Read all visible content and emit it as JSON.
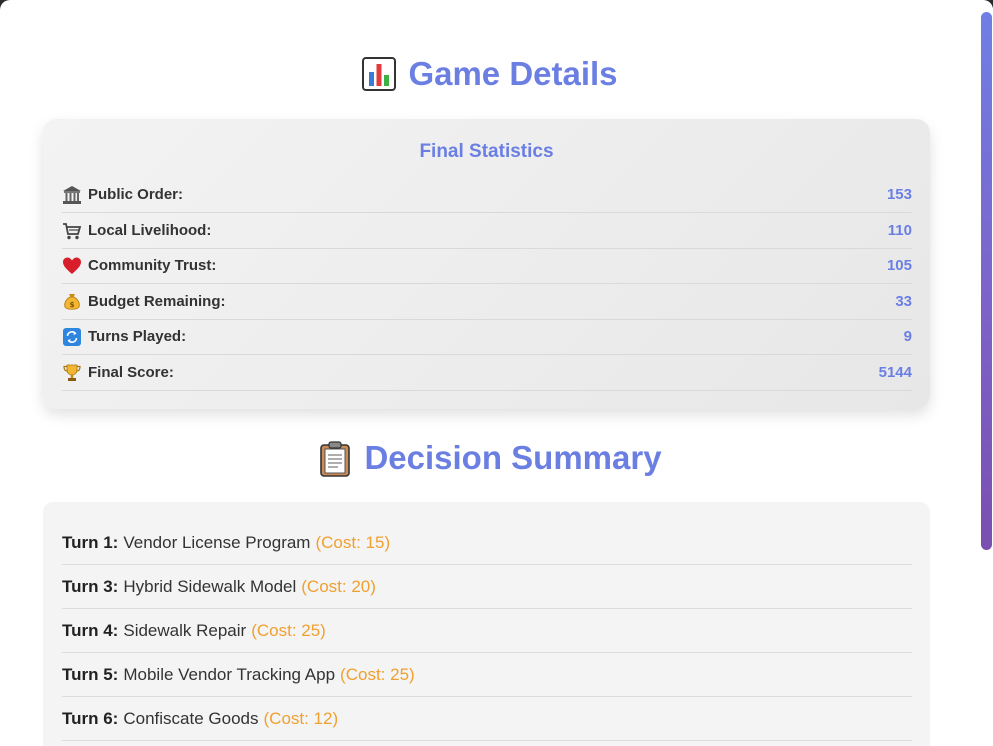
{
  "header": {
    "title": "Game Details",
    "icon": "bar-chart-icon"
  },
  "stats": {
    "heading": "Final Statistics",
    "rows": [
      {
        "icon": "bank-icon",
        "label": "Public Order:",
        "value": "153"
      },
      {
        "icon": "cart-icon",
        "label": "Local Livelihood:",
        "value": "110"
      },
      {
        "icon": "heart-icon",
        "label": "Community Trust:",
        "value": "105"
      },
      {
        "icon": "money-bag-icon",
        "label": "Budget Remaining:",
        "value": "33"
      },
      {
        "icon": "refresh-icon",
        "label": "Turns Played:",
        "value": "9"
      },
      {
        "icon": "trophy-icon",
        "label": "Final Score:",
        "value": "5144"
      }
    ]
  },
  "decisions": {
    "title": "Decision Summary",
    "icon": "clipboard-icon",
    "rows": [
      {
        "turn": "Turn 1:",
        "action": "Vendor License Program",
        "cost": "(Cost: 15)"
      },
      {
        "turn": "Turn 3:",
        "action": "Hybrid Sidewalk Model",
        "cost": "(Cost: 20)"
      },
      {
        "turn": "Turn 4:",
        "action": "Sidewalk Repair",
        "cost": "(Cost: 25)"
      },
      {
        "turn": "Turn 5:",
        "action": "Mobile Vendor Tracking App",
        "cost": "(Cost: 25)"
      },
      {
        "turn": "Turn 6:",
        "action": "Confiscate Goods",
        "cost": "(Cost: 12)"
      }
    ]
  },
  "colors": {
    "accent": "#6b7fe3",
    "cost": "#f0a030",
    "scrollbar_top": "#6f7fe4",
    "scrollbar_bottom": "#7a4fb0"
  }
}
